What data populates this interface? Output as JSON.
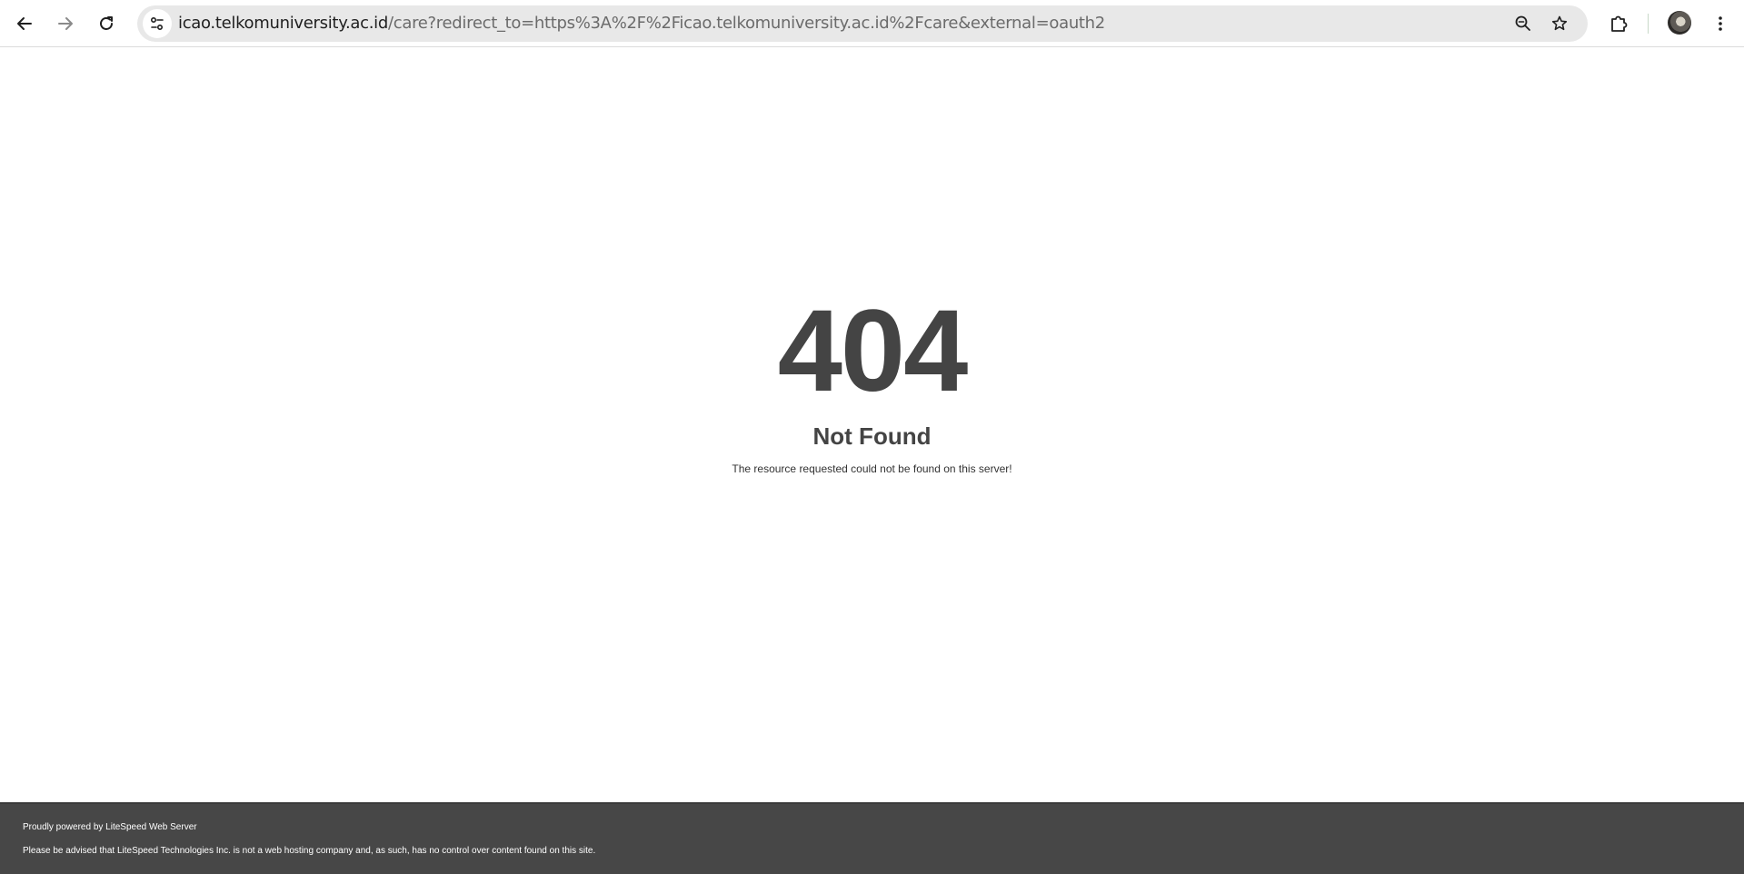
{
  "browser": {
    "url_host": "icao.telkomuniversity.ac.id",
    "url_path": "/care?redirect_to=https%3A%2F%2Ficao.telkomuniversity.ac.id%2Fcare&external=oauth2",
    "icons": {
      "back": "back-arrow-icon",
      "forward": "forward-arrow-icon",
      "reload": "reload-icon",
      "site_info": "tune-icon",
      "zoom": "zoom-icon",
      "bookmark": "star-icon",
      "extensions": "puzzle-icon",
      "profile": "avatar",
      "menu": "kebab-menu-icon"
    }
  },
  "page": {
    "code": "404",
    "title": "Not Found",
    "description": "The resource requested could not be found on this server!"
  },
  "footer": {
    "powered_by": "Proudly powered by LiteSpeed Web Server",
    "notice": "Please be advised that LiteSpeed Technologies Inc. is not a web hosting company and, as such, has no control over content found on this site."
  },
  "colors": {
    "text": "#444444",
    "footer_bg": "#474747",
    "omnibox_bg": "#e8e8e8"
  }
}
